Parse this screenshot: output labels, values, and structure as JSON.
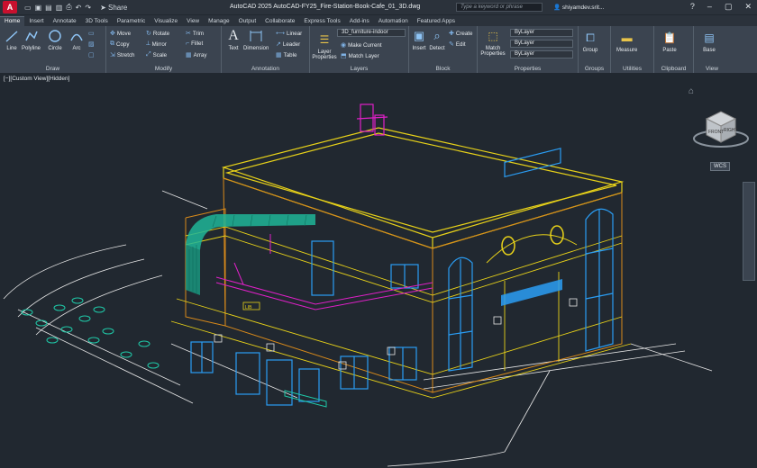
{
  "window": {
    "app_icon": "A",
    "title": "AutoCAD 2025    AutoCAD-FY25_Fire-Station-Book-Cafe_01_3D.dwg",
    "search_placeholder": "Type a keyword or phrase",
    "user": "shiyamdev.srit...",
    "share_label": "Share"
  },
  "tabs": [
    "Home",
    "Insert",
    "Annotate",
    "3D Tools",
    "Parametric",
    "Visualize",
    "View",
    "Manage",
    "Output",
    "Collaborate",
    "Express Tools",
    "Add-ins",
    "Automation",
    "Featured Apps"
  ],
  "ribbon": {
    "draw": {
      "title": "Draw",
      "line": "Line",
      "polyline": "Polyline",
      "circle": "Circle",
      "arc": "Arc"
    },
    "modify": {
      "title": "Modify",
      "move": "Move",
      "rotate": "Rotate",
      "trim": "Trim",
      "copy": "Copy",
      "mirror": "Mirror",
      "fillet": "Fillet",
      "stretch": "Stretch",
      "scale": "Scale",
      "array": "Array"
    },
    "annotation": {
      "title": "Annotation",
      "text": "Text",
      "dimension": "Dimension",
      "linear": "Linear",
      "leader": "Leader",
      "table": "Table"
    },
    "layers": {
      "title": "Layers",
      "layer_properties": "Layer Properties",
      "current_layer": "3D_furniture-indoor",
      "make_current": "Make Current",
      "match_layer": "Match Layer"
    },
    "block": {
      "title": "Block",
      "insert": "Insert",
      "detect": "Detect",
      "create": "Create",
      "edit": "Edit"
    },
    "properties": {
      "title": "Properties",
      "match_properties": "Match Properties",
      "color": "ByLayer",
      "linetype": "ByLayer",
      "lineweight": "ByLayer"
    },
    "groups": {
      "title": "Groups",
      "group": "Group"
    },
    "utilities": {
      "title": "Utilities",
      "measure": "Measure"
    },
    "clipboard": {
      "title": "Clipboard",
      "paste": "Paste"
    },
    "view": {
      "title": "View",
      "base": "Base"
    }
  },
  "viewport": {
    "label": "[−][Custom View][Hidden]",
    "wcs": "WCS",
    "viewcube_front": "FRONT",
    "viewcube_right": "RIGHT",
    "sign": "LIB"
  },
  "colors": {
    "accent": "#c8102e",
    "wire_yellow": "#e8d219",
    "wire_orange": "#d98a1a",
    "wire_teal": "#1fc9a8",
    "wire_blue": "#2a9df4",
    "wire_magenta": "#e020c8",
    "wire_white": "#e6e6e6"
  }
}
